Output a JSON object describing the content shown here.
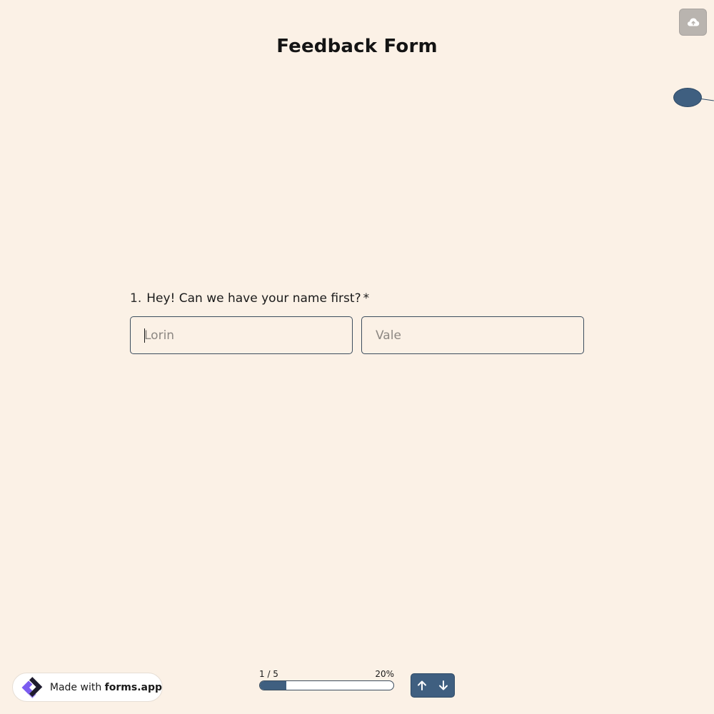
{
  "form": {
    "title": "Feedback Form"
  },
  "question": {
    "number": "1.",
    "text": "Hey! Can we have your name first?",
    "required_mark": "*",
    "first_name": {
      "value": "",
      "placeholder": "Lorin"
    },
    "last_name": {
      "value": "",
      "placeholder": "Vale"
    }
  },
  "progress": {
    "step_label": "1 / 5",
    "percent_label": "20%",
    "fraction": 0.2
  },
  "badge": {
    "prefix": "Made with",
    "brand": "forms.app"
  },
  "icons": {
    "upload": "cloud-upload-icon",
    "logo": "forms-app-logo-icon",
    "prev": "arrow-up-icon",
    "next": "arrow-down-icon"
  },
  "colors": {
    "background": "#FBF1E6",
    "accent": "#3F5F80",
    "upload_button": "#B9B4AF",
    "input_border": "#3C4D5E",
    "logo_purple": "#7B5CF0",
    "logo_dark": "#1E1B2E"
  }
}
